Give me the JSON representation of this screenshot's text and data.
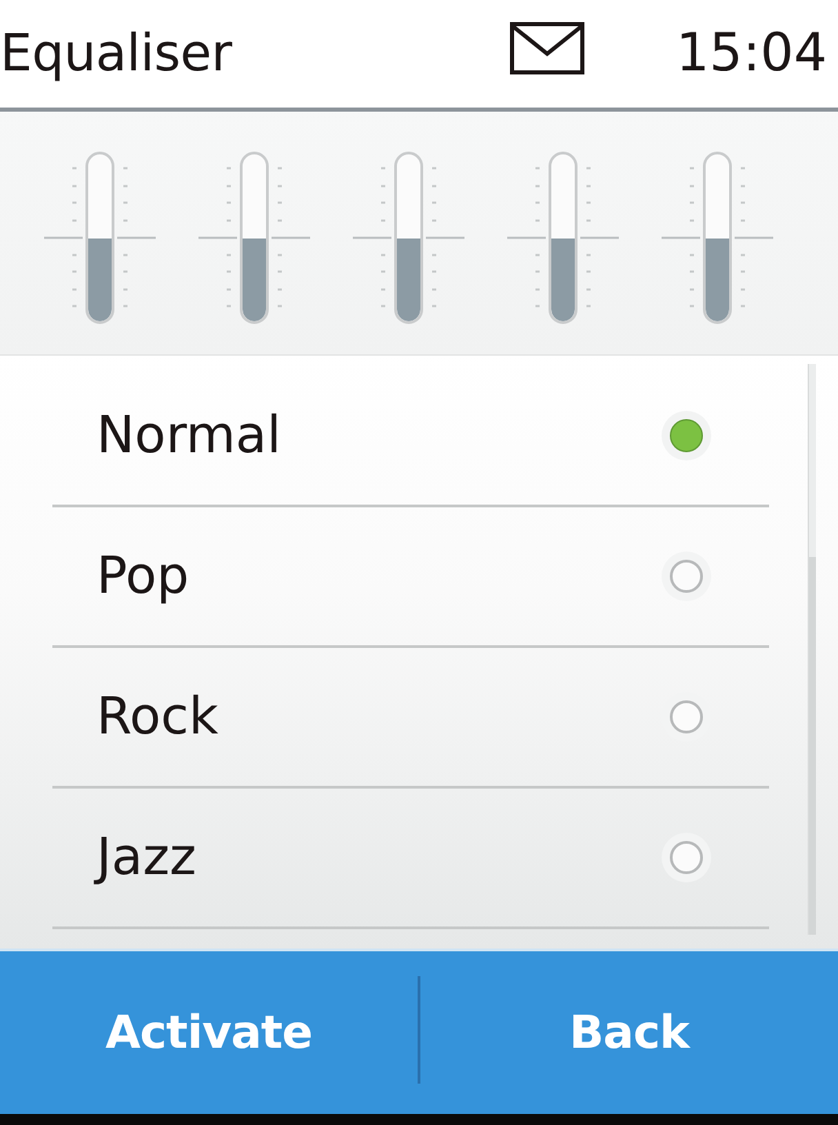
{
  "status_bar": {
    "title": "Equaliser",
    "message_indicator": true,
    "time": "15:04"
  },
  "bands": [
    {
      "level": 0.5
    },
    {
      "level": 0.5
    },
    {
      "level": 0.5
    },
    {
      "level": 0.5
    },
    {
      "level": 0.5
    }
  ],
  "presets": [
    {
      "label": "Normal",
      "selected": true
    },
    {
      "label": "Pop",
      "selected": false
    },
    {
      "label": "Rock",
      "selected": false
    },
    {
      "label": "Jazz",
      "selected": false
    }
  ],
  "softkeys": [
    {
      "label": "Activate"
    },
    {
      "label": "Back"
    }
  ]
}
